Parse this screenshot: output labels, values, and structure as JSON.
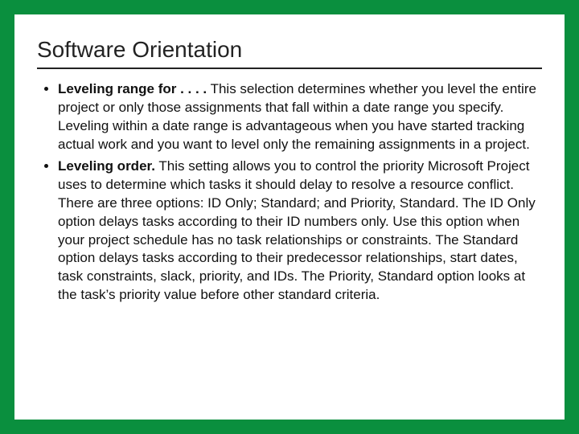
{
  "title": "Software Orientation",
  "bullets": [
    {
      "term": "Leveling range for . . . .",
      "body": " This selection determines whether you level the entire project or only those assignments that fall within a date range you specify. Leveling within a date range is advantageous when you have started tracking actual work and you want to level only the remaining assignments in a project."
    },
    {
      "term": "Leveling order.",
      "body": " This setting allows you to control the priority Microsoft Project uses to determine which tasks it should delay to resolve a resource conflict. There are three options: ID Only; Standard; and Priority, Standard. The ID Only option delays tasks according to their ID numbers only. Use this option when your project schedule has no task relationships or constraints. The Standard option delays tasks according to their predecessor relationships, start dates, task constraints, slack, priority, and IDs. The Priority, Standard option looks at the task’s priority value before other standard criteria."
    }
  ]
}
